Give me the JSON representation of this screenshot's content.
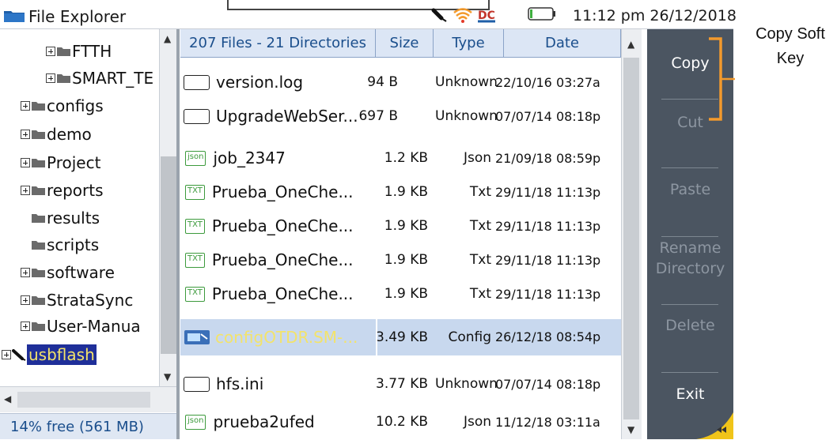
{
  "window": {
    "title": "File Explorer",
    "clock": "11:12 pm 26/12/2018"
  },
  "tree": {
    "items": [
      {
        "label": "FTTH",
        "indent": 2,
        "expandable": true
      },
      {
        "label": "SMART_TE",
        "indent": 2,
        "expandable": true
      },
      {
        "label": "configs",
        "indent": 1,
        "expandable": true
      },
      {
        "label": "demo",
        "indent": 1,
        "expandable": true
      },
      {
        "label": "Project",
        "indent": 1,
        "expandable": true
      },
      {
        "label": "reports",
        "indent": 1,
        "expandable": true
      },
      {
        "label": "results",
        "indent": 1,
        "expandable": false
      },
      {
        "label": "scripts",
        "indent": 1,
        "expandable": false
      },
      {
        "label": "software",
        "indent": 1,
        "expandable": true
      },
      {
        "label": "StrataSync",
        "indent": 1,
        "expandable": true
      },
      {
        "label": "User-Manua",
        "indent": 1,
        "expandable": true
      },
      {
        "label": "usbflash",
        "indent": 0,
        "expandable": true,
        "selected": true
      }
    ],
    "free_space": "14% free (561 MB)"
  },
  "files": {
    "summary": "207 Files - 21 Directories",
    "columns": {
      "size": "Size",
      "type": "Type",
      "date": "Date"
    },
    "rows": [
      {
        "name": "version.log",
        "icon": "plain-file-icon",
        "size": "94 B",
        "type": "Unknown",
        "date": "22/10/16 03:27a"
      },
      {
        "name": "UpgradeWebSer...",
        "icon": "plain-file-icon",
        "size": "697 B",
        "type": "Unknown",
        "date": "07/07/14 08:18p"
      },
      {
        "name": "job_2347",
        "icon": "json-file-icon",
        "badge": "json",
        "size": "1.2 KB",
        "type": "Json",
        "date": "21/09/18 08:59p"
      },
      {
        "name": "Prueba_OneChe...",
        "icon": "txt-file-icon",
        "badge": "TXT",
        "size": "1.9 KB",
        "type": "Txt",
        "date": "29/11/18 11:13p"
      },
      {
        "name": "Prueba_OneChe...",
        "icon": "txt-file-icon",
        "badge": "TXT",
        "size": "1.9 KB",
        "type": "Txt",
        "date": "29/11/18 11:13p"
      },
      {
        "name": "Prueba_OneChe...",
        "icon": "txt-file-icon",
        "badge": "TXT",
        "size": "1.9 KB",
        "type": "Txt",
        "date": "29/11/18 11:13p"
      },
      {
        "name": "Prueba_OneChe...",
        "icon": "txt-file-icon",
        "badge": "TXT",
        "size": "1.9 KB",
        "type": "Txt",
        "date": "29/11/18 11:13p"
      },
      {
        "name": "configOTDR.SM-...",
        "icon": "config-file-icon",
        "size": "3.49 KB",
        "type": "Config",
        "date": "26/12/18 08:54p",
        "selected": true
      },
      {
        "name": "hfs.ini",
        "icon": "plain-file-icon",
        "size": "3.77 KB",
        "type": "Unknown",
        "date": "07/07/14 08:18p"
      },
      {
        "name": "prueba2ufed",
        "icon": "json-file-icon",
        "badge": "json",
        "size": "10.2 KB",
        "type": "Json",
        "date": "11/12/18 03:11a"
      }
    ]
  },
  "softkeys": [
    {
      "label": "Copy",
      "enabled": true
    },
    {
      "label": "Cut",
      "enabled": false
    },
    {
      "label": "Paste",
      "enabled": false
    },
    {
      "label": "Rename Directory",
      "enabled": false
    },
    {
      "label": "Delete",
      "enabled": false
    },
    {
      "label": "Exit",
      "enabled": true
    }
  ],
  "annotation": {
    "text": "Copy Soft Key"
  },
  "colors": {
    "softkey_panel": "#4b5561",
    "header_blue": "#1a4e8c",
    "selection_yellow": "#f3e36a",
    "annotation_orange": "#f39a2c"
  }
}
